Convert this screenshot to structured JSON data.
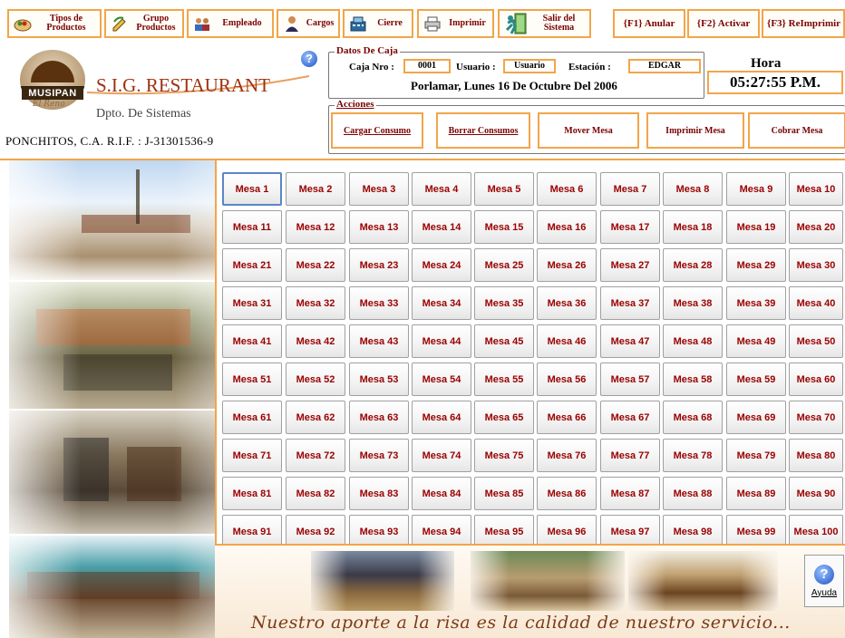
{
  "toolbar": {
    "buttons": [
      {
        "label": "Tipos de Productos",
        "icon": "food-plate-icon"
      },
      {
        "label": "Grupo Productos",
        "icon": "pencil-edit-icon"
      },
      {
        "label": "Empleado",
        "icon": "people-icon"
      },
      {
        "label": "Cargos",
        "icon": "person-icon"
      },
      {
        "label": "Cierre",
        "icon": "cash-register-icon"
      },
      {
        "label": "Imprimir",
        "icon": "printer-icon"
      },
      {
        "label": "Salir del Sistema",
        "icon": "exit-door-icon"
      }
    ],
    "fkeys": [
      "{F1} Anular",
      "{F2} Activar",
      "{F3} ReImprimir"
    ]
  },
  "header": {
    "logo_text": "MUSIPAN",
    "logo_subtext": "El Reno",
    "brand": "S.I.G. RESTAURANT",
    "department": "Dpto. De Sistemas",
    "company": "PONCHITOS, C.A. R.I.F. : J-31301536-9"
  },
  "datos_caja": {
    "legend": "Datos De Caja",
    "caja_label": "Caja Nro :",
    "caja_value": "0001",
    "usuario_label": "Usuario :",
    "usuario_value": "Usuario",
    "estacion_label": "Estación :",
    "estacion_value": "EDGAR",
    "date_line": "Porlamar, Lunes 16 De Octubre Del 2006"
  },
  "hora": {
    "title": "Hora",
    "value": "05:27:55 P.M."
  },
  "acciones": {
    "legend": "Acciones",
    "buttons": [
      "Cargar Consumo",
      "Borrar Consumos",
      "Mover Mesa",
      "Imprimir Mesa",
      "Cobrar Mesa"
    ]
  },
  "mesas": [
    "Mesa 1",
    "Mesa 2",
    "Mesa 3",
    "Mesa 4",
    "Mesa 5",
    "Mesa 6",
    "Mesa 7",
    "Mesa 8",
    "Mesa 9",
    "Mesa 10",
    "Mesa 11",
    "Mesa 12",
    "Mesa 13",
    "Mesa 14",
    "Mesa 15",
    "Mesa 16",
    "Mesa 17",
    "Mesa 18",
    "Mesa 19",
    "Mesa 20",
    "Mesa 21",
    "Mesa 22",
    "Mesa 23",
    "Mesa 24",
    "Mesa 25",
    "Mesa 26",
    "Mesa 27",
    "Mesa 28",
    "Mesa 29",
    "Mesa 30",
    "Mesa 31",
    "Mesa 32",
    "Mesa 33",
    "Mesa 34",
    "Mesa 35",
    "Mesa 36",
    "Mesa 37",
    "Mesa 38",
    "Mesa 39",
    "Mesa 40",
    "Mesa 41",
    "Mesa 42",
    "Mesa 43",
    "Mesa 44",
    "Mesa 45",
    "Mesa 46",
    "Mesa 47",
    "Mesa 48",
    "Mesa 49",
    "Mesa 50",
    "Mesa 51",
    "Mesa 52",
    "Mesa 53",
    "Mesa 54",
    "Mesa 55",
    "Mesa 56",
    "Mesa 57",
    "Mesa 58",
    "Mesa 59",
    "Mesa 60",
    "Mesa 61",
    "Mesa 62",
    "Mesa 63",
    "Mesa 64",
    "Mesa 65",
    "Mesa 66",
    "Mesa 67",
    "Mesa 68",
    "Mesa 69",
    "Mesa 70",
    "Mesa 71",
    "Mesa 72",
    "Mesa 73",
    "Mesa 74",
    "Mesa 75",
    "Mesa 76",
    "Mesa 77",
    "Mesa 78",
    "Mesa 79",
    "Mesa 80",
    "Mesa 81",
    "Mesa 82",
    "Mesa 83",
    "Mesa 84",
    "Mesa 85",
    "Mesa 86",
    "Mesa 87",
    "Mesa 88",
    "Mesa 89",
    "Mesa 90",
    "Mesa 91",
    "Mesa 92",
    "Mesa 93",
    "Mesa 94",
    "Mesa 95",
    "Mesa 96",
    "Mesa 97",
    "Mesa 98",
    "Mesa 99",
    "Mesa 100"
  ],
  "footer": {
    "slogan": "Nuestro aporte a la risa es la calidad de nuestro servicio...",
    "help_label": "Ayuda"
  },
  "colors": {
    "accent_border": "#f2a54a",
    "label_text": "#7a0000",
    "mesa_text": "#9a0000",
    "brand_text": "#a03010"
  }
}
